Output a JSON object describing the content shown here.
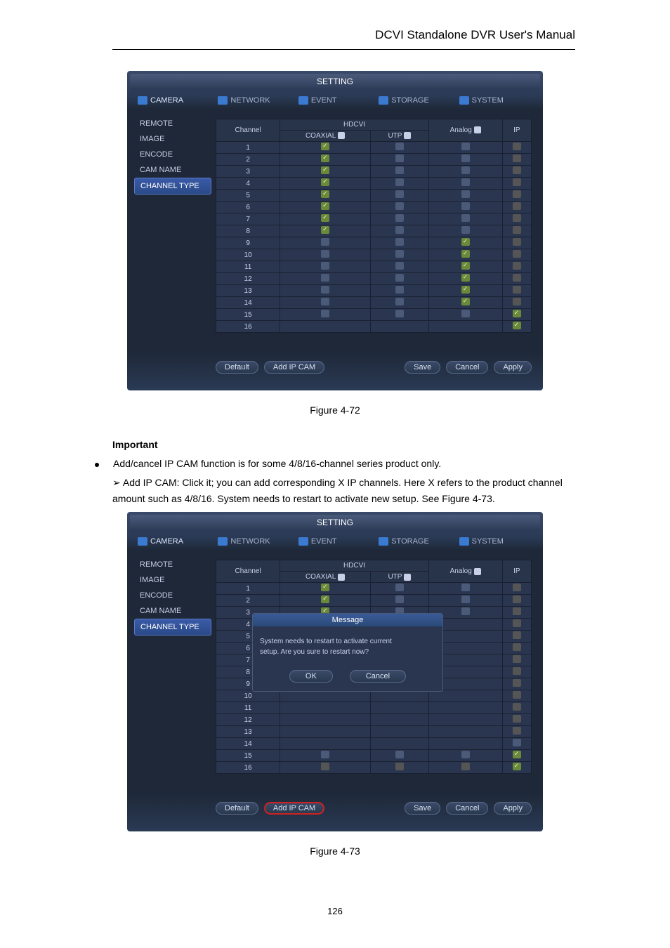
{
  "header": {
    "title": "DCVI Standalone DVR User's Manual"
  },
  "window": {
    "title": "SETTING"
  },
  "tabs": [
    {
      "label": "CAMERA",
      "active": true
    },
    {
      "label": "NETWORK",
      "active": false
    },
    {
      "label": "EVENT",
      "active": false
    },
    {
      "label": "STORAGE",
      "active": false
    },
    {
      "label": "SYSTEM",
      "active": false
    }
  ],
  "sidebar": {
    "items": [
      {
        "label": "REMOTE",
        "active": false
      },
      {
        "label": "IMAGE",
        "active": false
      },
      {
        "label": "ENCODE",
        "active": false
      },
      {
        "label": "CAM NAME",
        "active": false
      },
      {
        "label": "CHANNEL TYPE",
        "active": true
      }
    ]
  },
  "grid": {
    "headers": {
      "channel": "Channel",
      "hdcvi": "HDCVI",
      "coaxial": "COAXIAL",
      "utp": "UTP",
      "analog": "Analog",
      "ip": "IP"
    }
  },
  "channels1": [
    {
      "n": "1",
      "coaxial": "checked",
      "utp": "unchecked",
      "analog": "unchecked",
      "ip": "disabled"
    },
    {
      "n": "2",
      "coaxial": "checked",
      "utp": "unchecked",
      "analog": "unchecked",
      "ip": "disabled"
    },
    {
      "n": "3",
      "coaxial": "checked",
      "utp": "unchecked",
      "analog": "unchecked",
      "ip": "disabled"
    },
    {
      "n": "4",
      "coaxial": "checked",
      "utp": "unchecked",
      "analog": "unchecked",
      "ip": "disabled"
    },
    {
      "n": "5",
      "coaxial": "checked",
      "utp": "unchecked",
      "analog": "unchecked",
      "ip": "disabled"
    },
    {
      "n": "6",
      "coaxial": "checked",
      "utp": "unchecked",
      "analog": "unchecked",
      "ip": "disabled"
    },
    {
      "n": "7",
      "coaxial": "checked",
      "utp": "unchecked",
      "analog": "unchecked",
      "ip": "disabled"
    },
    {
      "n": "8",
      "coaxial": "checked",
      "utp": "unchecked",
      "analog": "unchecked",
      "ip": "disabled"
    },
    {
      "n": "9",
      "coaxial": "unchecked",
      "utp": "unchecked",
      "analog": "checked",
      "ip": "disabled"
    },
    {
      "n": "10",
      "coaxial": "unchecked",
      "utp": "unchecked",
      "analog": "checked",
      "ip": "disabled"
    },
    {
      "n": "11",
      "coaxial": "unchecked",
      "utp": "unchecked",
      "analog": "checked",
      "ip": "disabled"
    },
    {
      "n": "12",
      "coaxial": "unchecked",
      "utp": "unchecked",
      "analog": "checked",
      "ip": "disabled"
    },
    {
      "n": "13",
      "coaxial": "unchecked",
      "utp": "unchecked",
      "analog": "checked",
      "ip": "disabled"
    },
    {
      "n": "14",
      "coaxial": "unchecked",
      "utp": "unchecked",
      "analog": "checked",
      "ip": "disabled"
    },
    {
      "n": "15",
      "coaxial": "unchecked",
      "utp": "unchecked",
      "analog": "unchecked",
      "ip": "checked"
    },
    {
      "n": "16",
      "coaxial": "",
      "utp": "",
      "analog": "",
      "ip": "checked"
    }
  ],
  "channels2": [
    {
      "n": "1",
      "coaxial": "checked",
      "utp": "unchecked",
      "analog": "unchecked",
      "ip": "disabled"
    },
    {
      "n": "2",
      "coaxial": "checked",
      "utp": "unchecked",
      "analog": "unchecked",
      "ip": "disabled"
    },
    {
      "n": "3",
      "coaxial": "checked",
      "utp": "unchecked",
      "analog": "unchecked",
      "ip": "disabled"
    },
    {
      "n": "4",
      "coaxial": "",
      "utp": "",
      "analog": "",
      "ip": "disabled"
    },
    {
      "n": "5",
      "coaxial": "",
      "utp": "",
      "analog": "",
      "ip": "disabled"
    },
    {
      "n": "6",
      "coaxial": "",
      "utp": "",
      "analog": "",
      "ip": "disabled"
    },
    {
      "n": "7",
      "coaxial": "",
      "utp": "",
      "analog": "",
      "ip": "disabled"
    },
    {
      "n": "8",
      "coaxial": "",
      "utp": "",
      "analog": "",
      "ip": "disabled"
    },
    {
      "n": "9",
      "coaxial": "",
      "utp": "",
      "analog": "",
      "ip": "disabled"
    },
    {
      "n": "10",
      "coaxial": "",
      "utp": "",
      "analog": "",
      "ip": "disabled"
    },
    {
      "n": "11",
      "coaxial": "",
      "utp": "",
      "analog": "",
      "ip": "disabled"
    },
    {
      "n": "12",
      "coaxial": "",
      "utp": "",
      "analog": "",
      "ip": "disabled"
    },
    {
      "n": "13",
      "coaxial": "",
      "utp": "",
      "analog": "",
      "ip": "disabled"
    },
    {
      "n": "14",
      "coaxial": "",
      "utp": "",
      "analog": "",
      "ip": "unchecked"
    },
    {
      "n": "15",
      "coaxial": "unchecked",
      "utp": "unchecked",
      "analog": "unchecked",
      "ip": "checked"
    },
    {
      "n": "16",
      "coaxial": "disabled",
      "utp": "disabled",
      "analog": "disabled",
      "ip": "checked"
    }
  ],
  "buttons": {
    "default": "Default",
    "addipcam": "Add IP CAM",
    "save": "Save",
    "cancel": "Cancel",
    "apply": "Apply"
  },
  "caption1": "Figure 4-72",
  "caption2": "Figure 4-73",
  "text": {
    "important": "Important",
    "bullet": "Add/cancel IP CAM function is for some 4/8/16-channel series product only.",
    "addip_label": "Add IP CAM:",
    "addip_body": " Click it; you can add corresponding X IP channels. Here X refers to the product channel amount such as 4/8/16. System needs to restart to activate new setup. See Figure 4-73."
  },
  "modal": {
    "title": "Message",
    "line1": "System needs to restart to activate current",
    "line2": "setup. Are you sure to restart now?",
    "ok": "OK",
    "cancel": "Cancel"
  },
  "pagenum": "126"
}
